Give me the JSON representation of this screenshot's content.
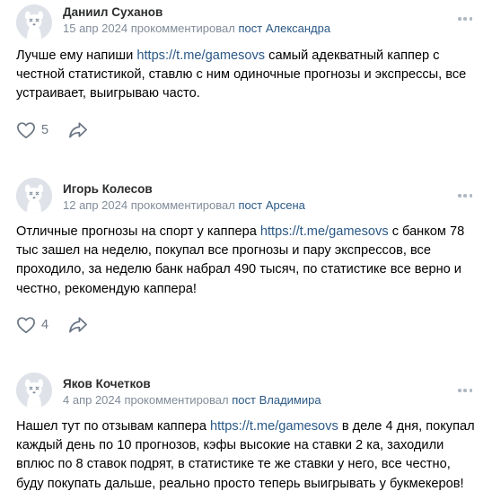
{
  "comments": [
    {
      "author": "Даниил Суханов",
      "date": "15 апр 2024",
      "action": "прокомментировал",
      "post_prefix": "пост",
      "post_author": "Александра",
      "text_before": "Лучше ему напиши ",
      "link": "https://t.me/gamesovs",
      "text_after": "  самый  адекватный каппер с честной статистикой, ставлю с ним одиночные прогнозы и экспрессы, все устраивает, выигрываю часто.",
      "likes": "5"
    },
    {
      "author": "Игорь Колесов",
      "date": "12 апр 2024",
      "action": "прокомментировал",
      "post_prefix": "пост",
      "post_author": "Арсена",
      "text_before": "Отличные прогнозы на спорт у каппера  ",
      "link": "https://t.me/gamesovs",
      "text_after": "  с банком 78 тыс зашел на неделю, покупал все прогнозы и пару экспрессов, все проходило, за неделю банк набрал 490 тысяч, по статистике все верно и честно, рекомендую каппера!",
      "likes": "4"
    },
    {
      "author": "Яков Кочетков",
      "date": "4 апр 2024",
      "action": "прокомментировал",
      "post_prefix": "пост",
      "post_author": "Владимира",
      "text_before": "Нашел тут по отзывам каппера  ",
      "link": "https://t.me/gamesovs",
      "text_after": "  в деле 4 дня, покупал каждый день по 10 прогнозов, кэфы высокие на ставки 2 ка, заходили вплюс по 8 ставок подрят, в статистике те же ставки у него, все честно, буду покупать дальше, реально просто теперь выигрывать у букмекеров!",
      "likes": ""
    }
  ],
  "icons": {
    "avatar": "deactivated-dog-avatar",
    "more": "more-horizontal-icon",
    "like": "heart-outline-icon",
    "share": "share-arrow-icon"
  },
  "colors": {
    "link": "#2a5885",
    "meta": "#818c99",
    "name": "#2c2d2e",
    "icon": "#6b7684",
    "avatar_bg": "#dfe3e9"
  }
}
